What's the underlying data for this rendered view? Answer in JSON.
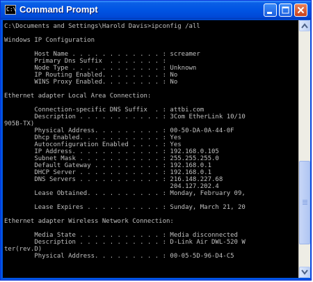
{
  "window": {
    "title": "Command Prompt",
    "icon_label": "C:\\",
    "controls": [
      "minimize-icon",
      "maximize-icon",
      "close-icon"
    ]
  },
  "console": {
    "lines": [
      "C:\\Documents and Settings\\Harold Davis>ipconfig /all",
      "",
      "Windows IP Configuration",
      "",
      "        Host Name . . . . . . . . . . . . : screamer",
      "        Primary Dns Suffix  . . . . . . . :",
      "        Node Type . . . . . . . . . . . . : Unknown",
      "        IP Routing Enabled. . . . . . . . : No",
      "        WINS Proxy Enabled. . . . . . . . : No",
      "",
      "Ethernet adapter Local Area Connection:",
      "",
      "        Connection-specific DNS Suffix  . : attbi.com",
      "        Description . . . . . . . . . . . : 3Com EtherLink 10/10",
      "905B-TX)",
      "        Physical Address. . . . . . . . . : 00-50-DA-0A-44-0F",
      "        Dhcp Enabled. . . . . . . . . . . : Yes",
      "        Autoconfiguration Enabled . . . . : Yes",
      "        IP Address. . . . . . . . . . . . : 192.168.0.105",
      "        Subnet Mask . . . . . . . . . . . : 255.255.255.0",
      "        Default Gateway . . . . . . . . . : 192.168.0.1",
      "        DHCP Server . . . . . . . . . . . : 192.168.0.1",
      "        DNS Servers . . . . . . . . . . . : 216.148.227.68",
      "                                            204.127.202.4",
      "        Lease Obtained. . . . . . . . . . : Monday, February 09,",
      "",
      "        Lease Expires . . . . . . . . . . : Sunday, March 21, 20",
      "",
      "Ethernet adapter Wireless Network Connection:",
      "",
      "        Media State . . . . . . . . . . . : Media disconnected",
      "        Description . . . . . . . . . . . : D-Link Air DWL-520 W",
      "ter(rev.D)",
      "        Physical Address. . . . . . . . . : 00-05-5D-96-D4-C5"
    ]
  },
  "colors": {
    "titlebar": "#0054e3",
    "console_background": "#000000",
    "console_text": "#c0c0c0",
    "close_button": "#d9522b"
  }
}
